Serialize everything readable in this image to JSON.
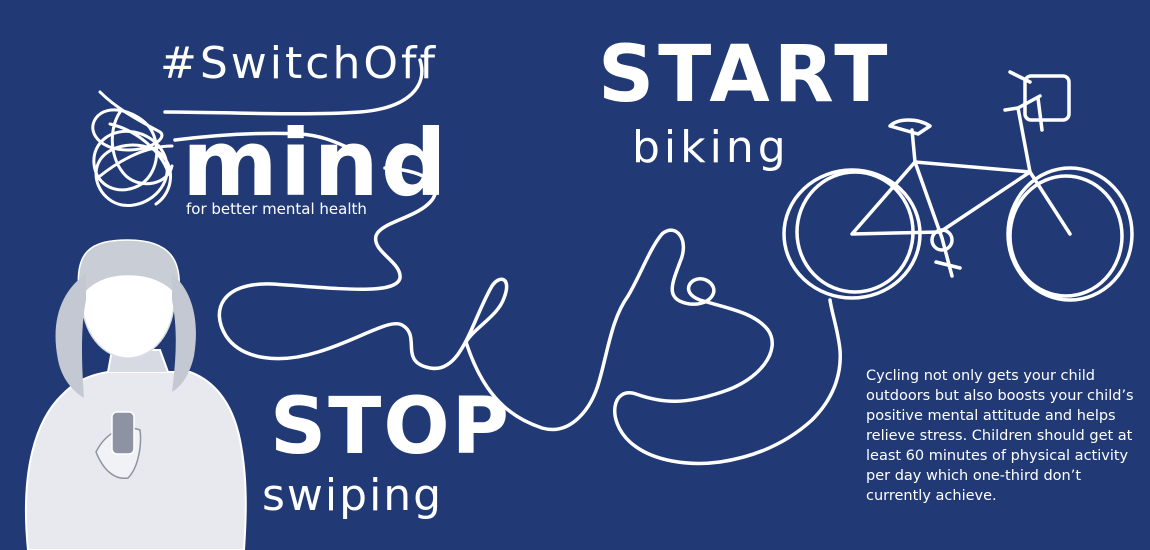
{
  "campaign": {
    "hashtag": "#SwitchOff",
    "brand_name": "mind",
    "tagline": "for better mental health"
  },
  "headline": {
    "start": "START",
    "biking": "biking",
    "stop": "STOP",
    "swiping": "swiping"
  },
  "body_text": "Cycling not only gets your child outdoors but also boosts your child’s positive mental attitude and helps relieve stress. Children should get at least 60 minutes of physical activity per day which one-third don’t currently achieve.",
  "colors": {
    "background": "#213a75",
    "foreground": "#ffffff"
  },
  "icons": [
    "mind-scribble-logo-icon",
    "bicycle-icon",
    "girl-with-phone-illustration"
  ]
}
